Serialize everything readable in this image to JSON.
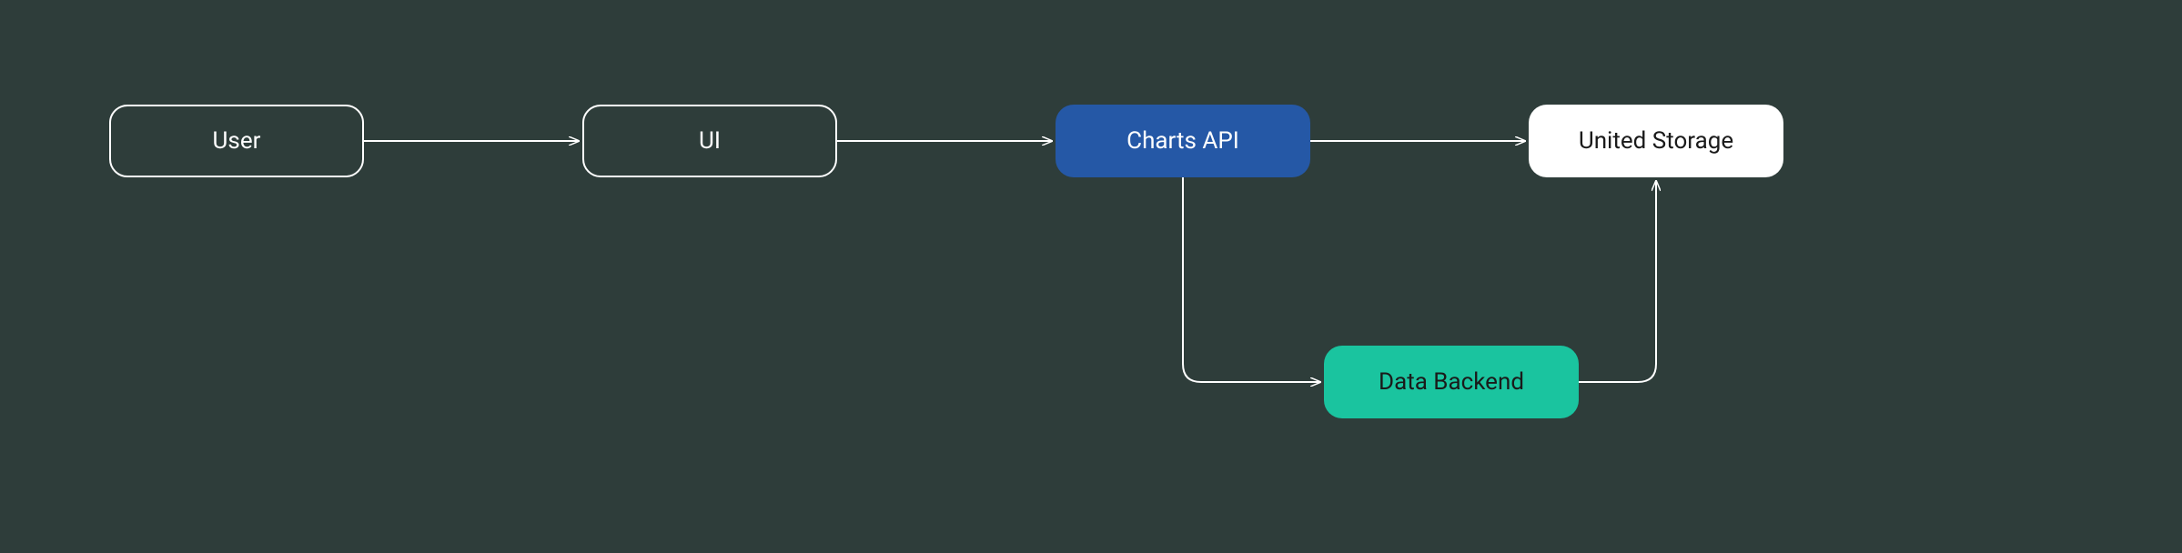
{
  "diagram": {
    "nodes": {
      "user": {
        "label": "User"
      },
      "ui": {
        "label": "UI"
      },
      "charts_api": {
        "label": "Charts API"
      },
      "united_storage": {
        "label": "United Storage"
      },
      "data_backend": {
        "label": "Data Backend"
      }
    },
    "edges": [
      {
        "from": "user",
        "to": "ui"
      },
      {
        "from": "ui",
        "to": "charts_api"
      },
      {
        "from": "charts_api",
        "to": "united_storage"
      },
      {
        "from": "charts_api",
        "to": "data_backend"
      },
      {
        "from": "data_backend",
        "to": "united_storage"
      }
    ],
    "colors": {
      "background": "#2e3d3a",
      "outline": "#ffffff",
      "blue": "#2558a6",
      "teal": "#1ac49f",
      "white": "#ffffff",
      "arrow": "#ffffff"
    }
  }
}
